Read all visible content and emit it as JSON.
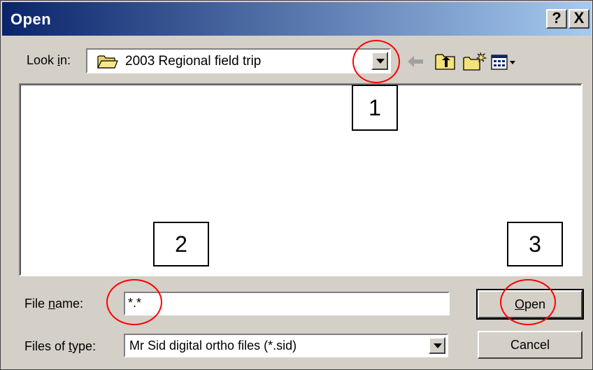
{
  "window": {
    "title": "Open",
    "help_label": "?",
    "close_label": "X"
  },
  "look_in": {
    "label_pre": "Look ",
    "label_accel": "i",
    "label_post": "n:",
    "value": "2003 Regional field trip"
  },
  "toolbar": {
    "icons": [
      "back-arrow-icon",
      "up-folder-icon",
      "new-folder-icon",
      "view-menu-icon"
    ]
  },
  "file_name": {
    "label_pre": "File ",
    "label_accel": "n",
    "label_post": "ame:",
    "value": "*.*"
  },
  "files_of_type": {
    "label_pre": "Files of ",
    "label_accel": "t",
    "label_post": "ype:",
    "value": "Mr Sid digital ortho files (*.sid)"
  },
  "buttons": {
    "open_accel": "O",
    "open_rest": "pen",
    "cancel": "Cancel"
  },
  "callouts": [
    "1",
    "2",
    "3"
  ],
  "annotation_color": "#ff0000"
}
